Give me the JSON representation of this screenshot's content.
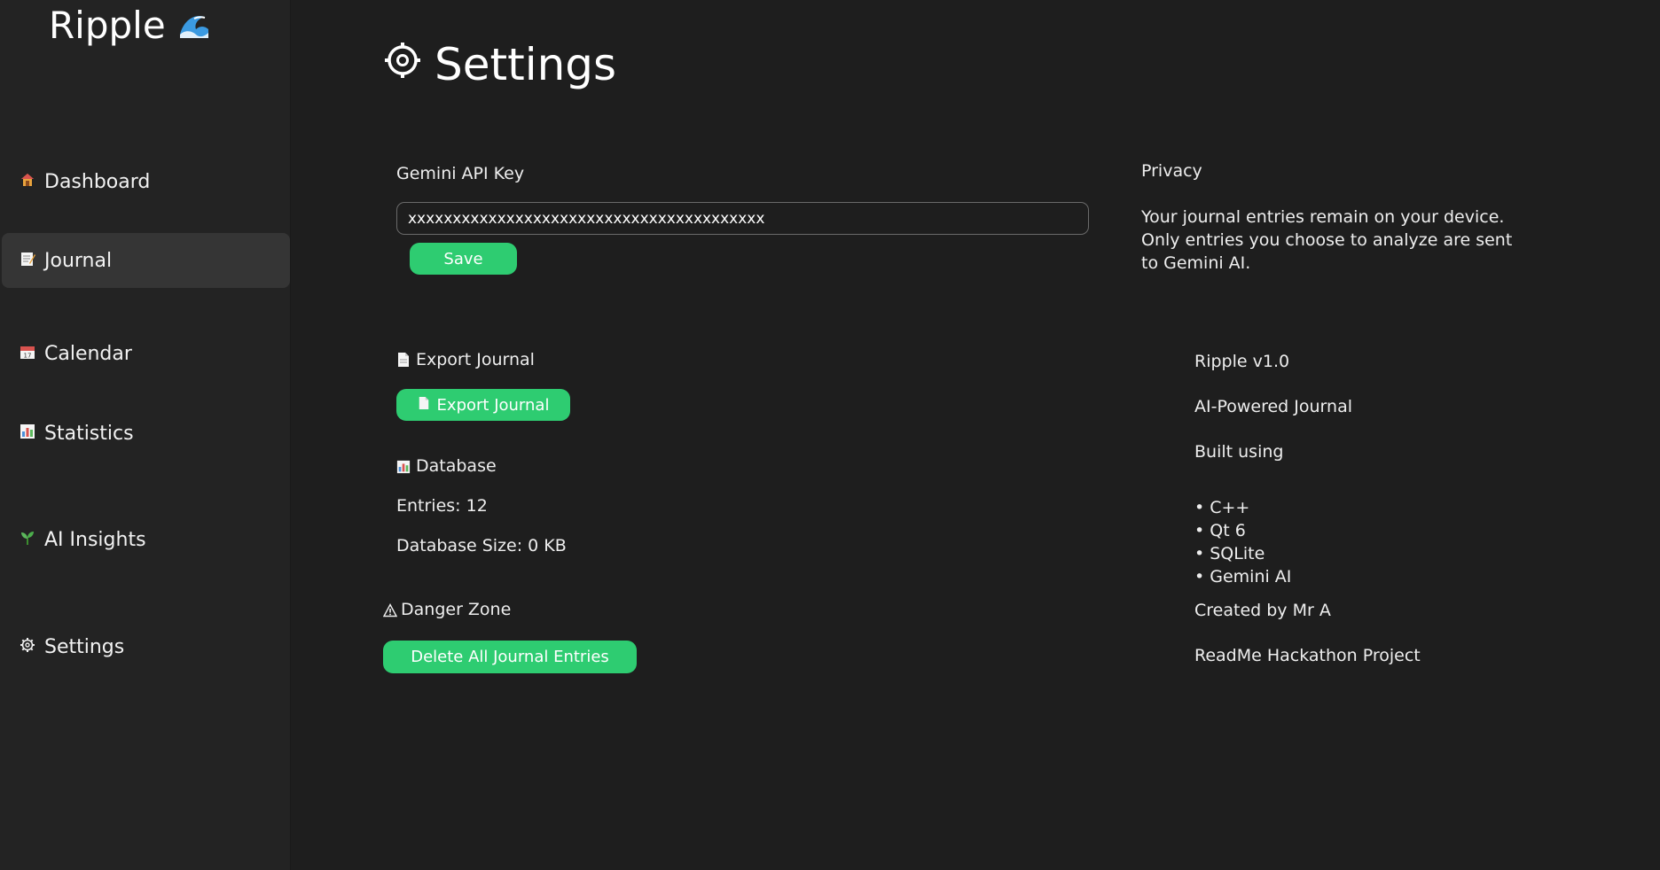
{
  "sidebar": {
    "brand": {
      "name": "Ripple",
      "icon": "wave-icon"
    },
    "items": [
      {
        "label": "Dashboard",
        "icon": "house-icon"
      },
      {
        "label": "Journal",
        "icon": "memo-icon",
        "active": true
      },
      {
        "label": "Calendar",
        "icon": "calendar-icon"
      },
      {
        "label": "Statistics",
        "icon": "bar-chart-icon"
      },
      {
        "label": "AI Insights",
        "icon": "seedling-icon"
      },
      {
        "label": "Settings",
        "icon": "gear-icon"
      }
    ]
  },
  "page": {
    "title": "Settings",
    "title_icon": "gear-icon"
  },
  "api": {
    "label": "Gemini API Key",
    "value": "xxxxxxxxxxxxxxxxxxxxxxxxxxxxxxxxxxxxxxxx",
    "save_label": "Save"
  },
  "export": {
    "label": "Export Journal",
    "button_label": "Export Journal",
    "icon": "document-icon"
  },
  "database": {
    "label": "Database",
    "icon": "bar-chart-icon",
    "entries": "Entries: 12",
    "size": "Database Size: 0 KB"
  },
  "danger": {
    "label": "Danger Zone",
    "icon": "warning-icon",
    "button_label": "Delete All Journal Entries"
  },
  "privacy": {
    "title": "Privacy",
    "text": "Your journal entries remain on your device. Only entries you choose to analyze are sent to Gemini AI."
  },
  "about": {
    "version": "Ripple v1.0",
    "tagline": "AI-Powered Journal",
    "built_using": "Built using",
    "tech": [
      "• C++",
      "• Qt 6",
      "• SQLite",
      "• Gemini AI"
    ],
    "author": "Created by Mr A",
    "project": "ReadMe Hackathon Project"
  },
  "colors": {
    "background": "#1e1e1e",
    "sidebar": "#232323",
    "active_item": "#353535",
    "accent": "#2ecc71",
    "text": "#eeeeee"
  }
}
